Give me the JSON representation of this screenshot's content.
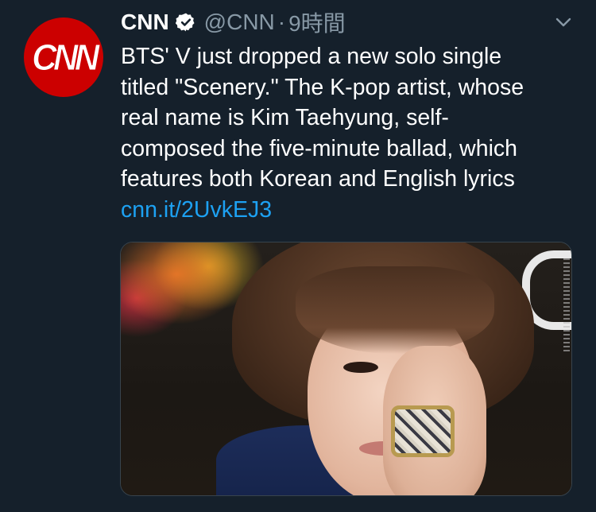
{
  "tweet": {
    "display_name": "CNN",
    "handle": "@CNN",
    "separator": "·",
    "time": "9時間",
    "avatar_logo": "CNN",
    "text_lines": [
      "BTS' V just dropped a new solo single",
      "titled \"Scenery.\" The K-pop artist, whose",
      "real name is Kim Taehyung, self-",
      "composed the five-minute ballad, which",
      "features both Korean and English lyrics"
    ],
    "link": "cnn.it/2UvkEJ3"
  },
  "icons": {
    "verified": "verified-badge-icon",
    "caret": "chevron-down-icon"
  },
  "colors": {
    "background": "#15202b",
    "secondary_text": "#8899a6",
    "link": "#1da1f2",
    "avatar": "#cc0000"
  }
}
